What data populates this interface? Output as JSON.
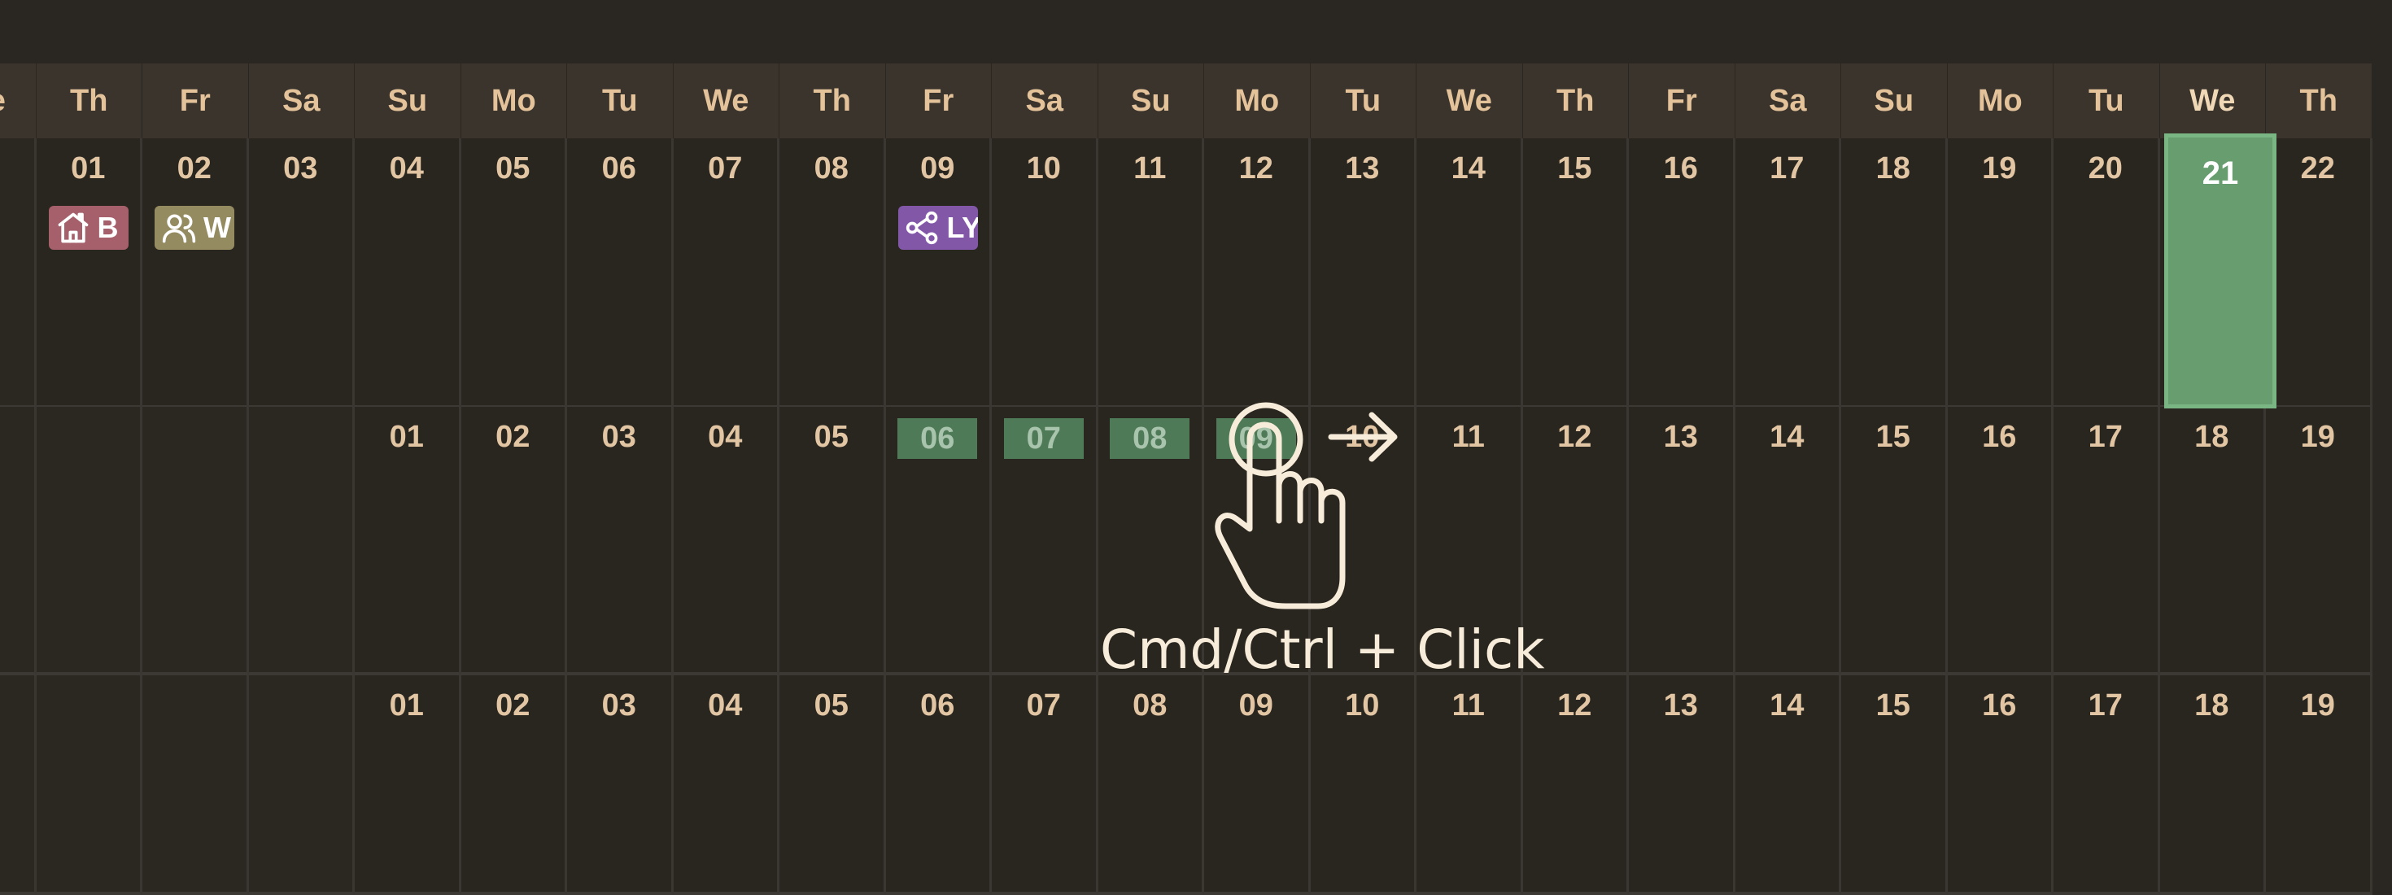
{
  "header_days": [
    "We",
    "Th",
    "Fr",
    "Sa",
    "Su",
    "Mo",
    "Tu",
    "We",
    "Th",
    "Fr",
    "Sa",
    "Su",
    "Mo",
    "Tu",
    "We",
    "Th",
    "Fr",
    "Sa",
    "Su",
    "Mo",
    "Tu",
    "We",
    "Th"
  ],
  "rows": [
    [
      "",
      "01",
      "02",
      "03",
      "04",
      "05",
      "06",
      "07",
      "08",
      "09",
      "10",
      "11",
      "12",
      "13",
      "14",
      "15",
      "16",
      "17",
      "18",
      "19",
      "20",
      "21",
      "22"
    ],
    [
      "",
      "",
      "",
      "",
      "01",
      "02",
      "03",
      "04",
      "05",
      "06",
      "07",
      "08",
      "09",
      "10",
      "11",
      "12",
      "13",
      "14",
      "15",
      "16",
      "17",
      "18",
      "19"
    ],
    [
      "",
      "",
      "",
      "",
      "01",
      "02",
      "03",
      "04",
      "05",
      "06",
      "07",
      "08",
      "09",
      "10",
      "11",
      "12",
      "13",
      "14",
      "15",
      "16",
      "17",
      "18",
      "19"
    ]
  ],
  "today_index": 21,
  "highlighted_days": [
    9,
    10,
    11,
    12
  ],
  "events": [
    {
      "label": "B",
      "icon": "house-icon",
      "color": "#a5606b",
      "col": 1
    },
    {
      "label": "W",
      "icon": "users-icon",
      "color": "#948b61",
      "col": 2
    },
    {
      "label": "LY",
      "icon": "share-icon",
      "color": "#8257a8",
      "col": 9
    }
  ],
  "hint": {
    "text": "Cmd/Ctrl + Click",
    "icon": "pointer-hand-icon",
    "arrow": "arrow-right-icon"
  },
  "colors": {
    "today_bg": "#679d6f",
    "today_border": "#7ab683",
    "highlight": "#4f7a57",
    "text": "#e2c6a4",
    "hint": "#f7ecd9"
  }
}
